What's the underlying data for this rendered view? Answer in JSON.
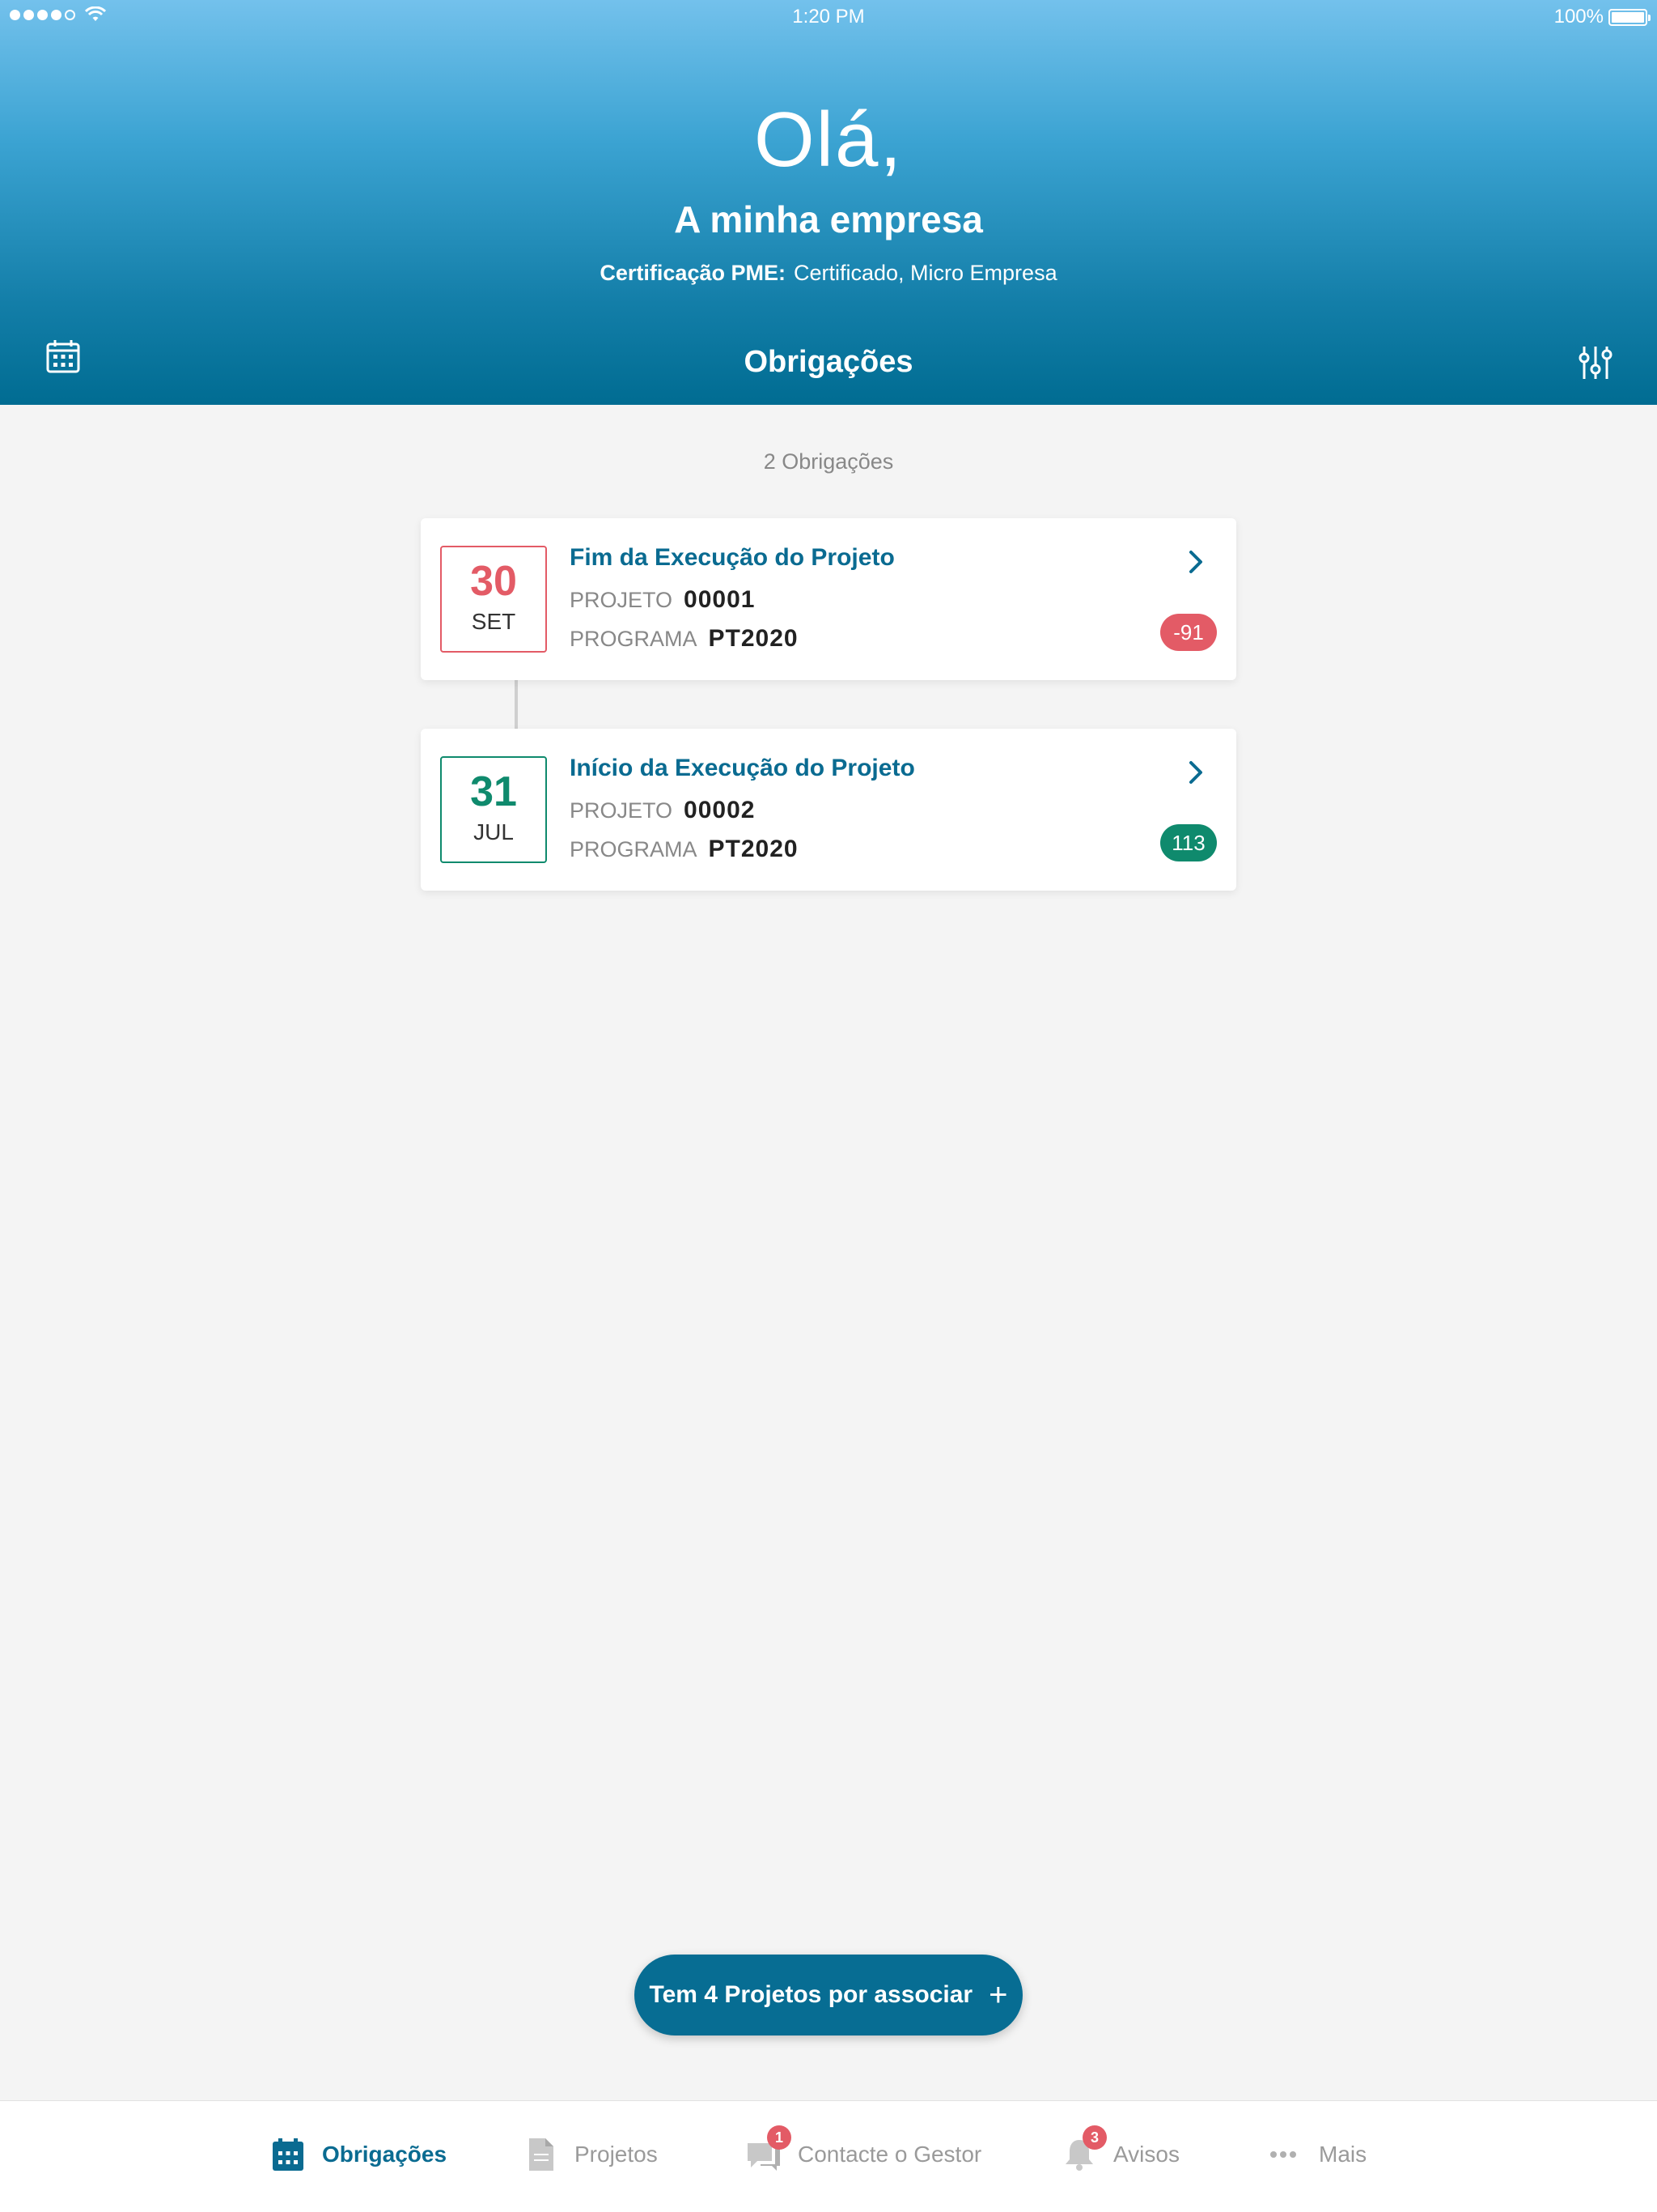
{
  "status_bar": {
    "time": "1:20 PM",
    "battery": "100%"
  },
  "header": {
    "greeting": "Olá,",
    "company": "A minha empresa",
    "cert_label": "Certificação PME:",
    "cert_value": "Certificado, Micro Empresa",
    "title": "Obrigações"
  },
  "summary": {
    "count_text": "2 Obrigações"
  },
  "cards": [
    {
      "day": "30",
      "month": "SET",
      "title": "Fim da Execução do Projeto",
      "projeto_label": "PROJETO",
      "projeto_value": "00001",
      "programa_label": "PROGRAMA",
      "programa_value": "PT2020",
      "badge": "-91",
      "color": "#e35b66"
    },
    {
      "day": "31",
      "month": "JUL",
      "title": "Início da Execução do Projeto",
      "projeto_label": "PROJETO",
      "projeto_value": "00002",
      "programa_label": "PROGRAMA",
      "programa_value": "PT2020",
      "badge": "113",
      "color": "#0f8a6d"
    }
  ],
  "fab": {
    "label": "Tem 4 Projetos por associar",
    "plus": "+"
  },
  "tabs": [
    {
      "label": "Obrigações",
      "icon": "calendar-icon",
      "active": true
    },
    {
      "label": "Projetos",
      "icon": "document-icon"
    },
    {
      "label": "Contacte o Gestor",
      "icon": "chat-icon",
      "badge": "1"
    },
    {
      "label": "Avisos",
      "icon": "bell-icon",
      "badge": "3"
    },
    {
      "label": "Mais",
      "icon": "more-icon"
    }
  ],
  "colors": {
    "accent": "#0a6b91",
    "header_top": "#73c1ec",
    "header_bottom": "#006c92",
    "danger": "#e35b66",
    "success": "#0f8a6d"
  }
}
